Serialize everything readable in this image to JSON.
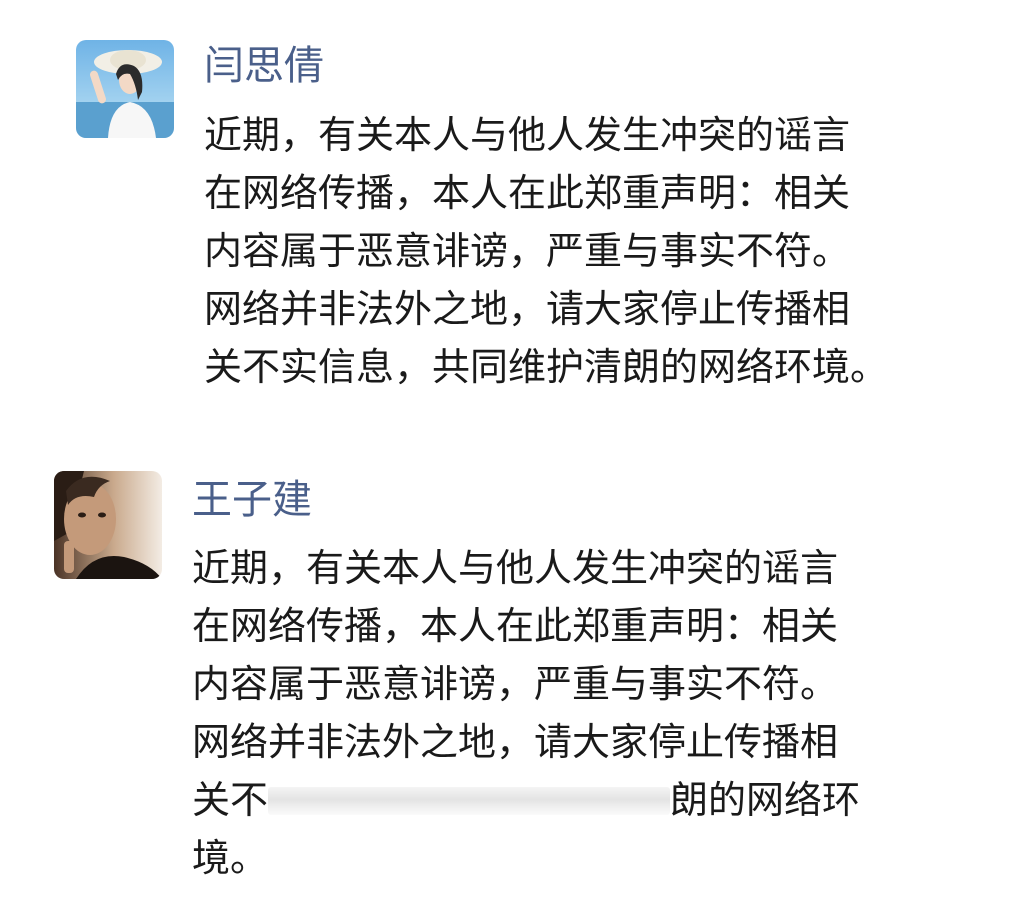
{
  "posts": [
    {
      "author": "闫思倩",
      "lines": [
        "近期，有关本人与他人发生冲突的谣言",
        "在网络传播，本人在此郑重声明：相关",
        "内容属于恶意诽谤，严重与事实不符。",
        "网络并非法外之地，请大家停止传播相",
        "关不实信息，共同维护清朗的网络环境。"
      ]
    },
    {
      "author": "王子建",
      "lines": [
        "近期，有关本人与他人发生冲突的谣言",
        "在网络传播，本人在此郑重声明：相关",
        "内容属于恶意诽谤，严重与事实不符。",
        "网络并非法外之地，请大家停止传播相"
      ],
      "line5_before": "关不",
      "line5_after": "朗的网络环",
      "line6": "境。"
    }
  ],
  "colors": {
    "author_name": "#4a5f8a",
    "body_text": "#1a1a1a",
    "background": "#ffffff"
  }
}
